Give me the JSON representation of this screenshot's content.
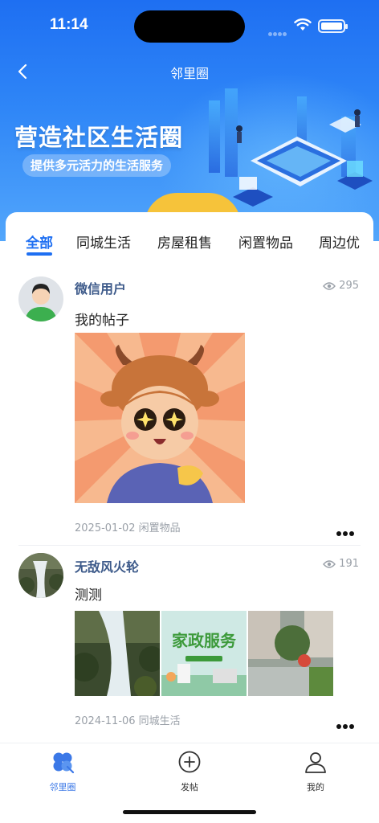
{
  "status_bar": {
    "time": "11:14"
  },
  "nav": {
    "title": "邻里圈",
    "back_icon": "chevron-left-icon"
  },
  "banner": {
    "title": "营造社区生活圈",
    "subtitle": "提供多元活力的生活服务"
  },
  "tabs": [
    {
      "label": "全部",
      "active": true
    },
    {
      "label": "同城生活",
      "active": false
    },
    {
      "label": "房屋租售",
      "active": false
    },
    {
      "label": "闲置物品",
      "active": false
    },
    {
      "label": "周边优",
      "active": false
    }
  ],
  "posts": [
    {
      "username": "微信用户",
      "views": "295",
      "text": "我的帖子",
      "date_category": "2025-01-02 闲置物品",
      "images": [
        "ox-cartoon-image"
      ]
    },
    {
      "username": "无敌风火轮",
      "views": "191",
      "text": "测测",
      "date_category": "2024-11-06 同城生活",
      "images": [
        "waterfall-image",
        "housekeeping-poster-image",
        "courtyard-image"
      ]
    }
  ],
  "bottom_nav": [
    {
      "label": "邻里圈",
      "icon": "clover-icon",
      "active": true
    },
    {
      "label": "发帖",
      "icon": "plus-circle-icon",
      "active": false
    },
    {
      "label": "我的",
      "icon": "user-icon",
      "active": false
    }
  ],
  "colors": {
    "accent": "#1e6ff2",
    "username": "#3d5a8a",
    "meta": "#9aa0a8"
  },
  "image_text": {
    "poster_title": "家政服务"
  }
}
